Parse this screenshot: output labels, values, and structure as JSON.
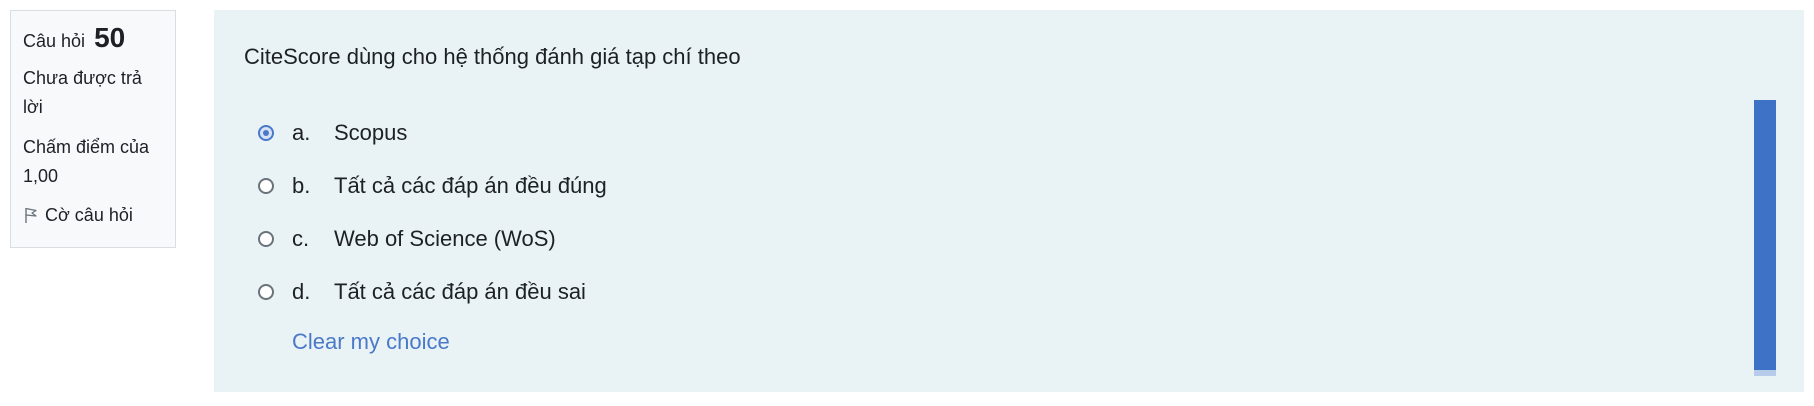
{
  "info": {
    "question_label": "Câu hỏi",
    "question_number": "50",
    "state": "Chưa được trả lời",
    "grade": "Chấm điểm của 1,00",
    "flag_label": "Cờ câu hỏi"
  },
  "question": {
    "text": "CiteScore dùng cho hệ thống đánh giá tạp chí theo",
    "answers": [
      {
        "letter": "a.",
        "label": "Scopus",
        "checked": true
      },
      {
        "letter": "b.",
        "label": "Tất cả các đáp án đều đúng",
        "checked": false
      },
      {
        "letter": "c.",
        "label": "Web of Science (WoS)",
        "checked": false
      },
      {
        "letter": "d.",
        "label": "Tất cả các đáp án đều sai",
        "checked": false
      }
    ],
    "clear_label": "Clear my choice"
  },
  "colors": {
    "accent": "#4a79c9",
    "content_bg": "#e9f2f5"
  }
}
